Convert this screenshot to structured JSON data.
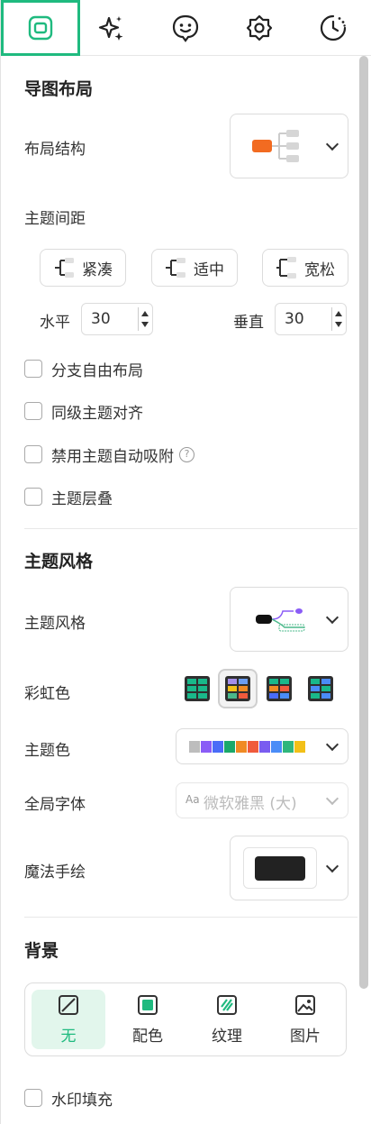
{
  "tabs": [
    {
      "name": "layout-tab-icon",
      "active": true
    },
    {
      "name": "sparkle-tab-icon",
      "active": false
    },
    {
      "name": "smiley-tab-icon",
      "active": false
    },
    {
      "name": "gear-flower-tab-icon",
      "active": false
    },
    {
      "name": "clock-tab-icon",
      "active": false
    }
  ],
  "layout": {
    "title": "导图布局",
    "structure_label": "布局结构",
    "spacing_label": "主题间距",
    "spacing_options": [
      "紧凑",
      "适中",
      "宽松"
    ],
    "horizontal_label": "水平",
    "horizontal_value": "30",
    "vertical_label": "垂直",
    "vertical_value": "30",
    "checks": [
      "分支自由布局",
      "同级主题对齐",
      "禁用主题自动吸附",
      "主题层叠"
    ]
  },
  "style": {
    "title": "主题风格",
    "style_label": "主题风格",
    "rainbow_label": "彩虹色",
    "color_label": "主题色",
    "palette": [
      "#bdbdbd",
      "#8a5cf6",
      "#4a6cf7",
      "#1aa86a",
      "#f08a24",
      "#f05a3c",
      "#7a5cf0",
      "#4a8cf7",
      "#2fb67c",
      "#f2c018"
    ],
    "font_label": "全局字体",
    "font_prefix": "Aa",
    "font_value": "微软雅黑 (大)",
    "magic_label": "魔法手绘"
  },
  "background": {
    "title": "背景",
    "options": [
      "无",
      "配色",
      "纹理",
      "图片"
    ],
    "watermark_label": "水印填充"
  },
  "colors": {
    "accent": "#1fba7f",
    "orange": "#f26b21"
  }
}
